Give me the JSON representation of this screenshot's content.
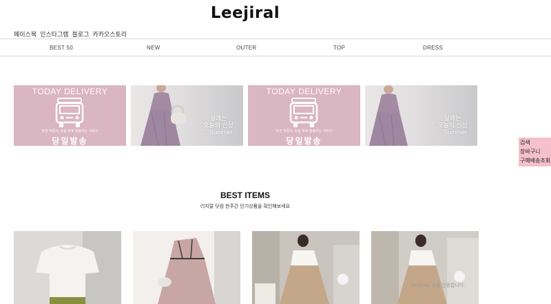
{
  "header": {
    "logo": "Leejiral",
    "social_links": [
      "페이스북",
      "인스타그램",
      "블로그",
      "카카오스토리"
    ]
  },
  "nav": {
    "items": [
      "BEST 50",
      "NEW",
      "OUTER",
      "TOP",
      "DRESS"
    ]
  },
  "banners": {
    "delivery": {
      "heading": "TODAY DELIVERY",
      "subtext": "'오전 주문시, 오늘 바로 발송되는 서비스'",
      "big_text": "당일발송"
    },
    "photo": {
      "line1": "설레는",
      "line2": "오늘의 신상",
      "line3": "♡Summer"
    }
  },
  "side_menu": {
    "items": [
      "검색",
      "장바구니",
      "구매배송조회"
    ]
  },
  "best": {
    "title": "BEST ITEMS",
    "subtitle": "리지랄 닷컴 한주간 인기상품을 확인해보세요"
  },
  "watermark": "Windows 정품 인증합니다.",
  "colors": {
    "delivery_pink": "#dab5c2",
    "side_menu_pink": "#f5c0cc"
  }
}
